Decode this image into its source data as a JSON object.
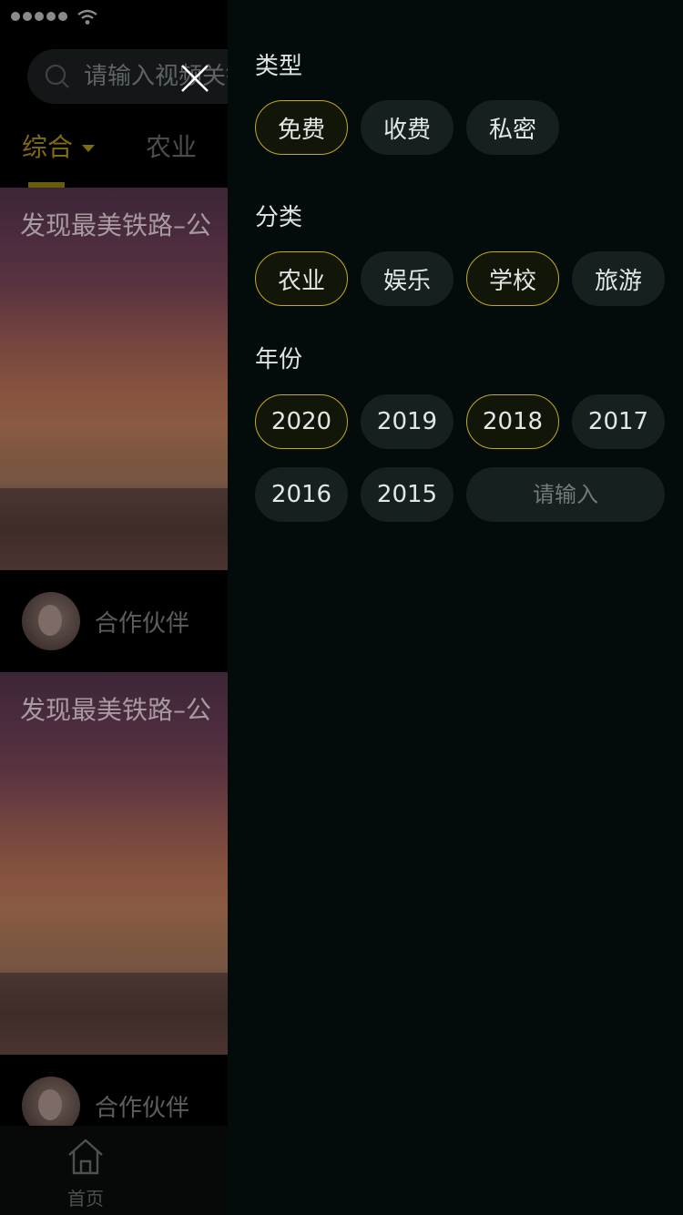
{
  "search": {
    "placeholder": "请输入视频关键词"
  },
  "tabs": [
    {
      "label": "综合",
      "active": true
    },
    {
      "label": "农业",
      "active": false
    }
  ],
  "feed": [
    {
      "title": "发现最美铁路–公",
      "author": "合作伙伴"
    },
    {
      "title": "发现最美铁路–公",
      "author": "合作伙伴"
    }
  ],
  "bottom_nav": {
    "home_label": "首页"
  },
  "filter": {
    "type_title": "类型",
    "type_options": [
      {
        "label": "免费",
        "selected": true
      },
      {
        "label": "收费",
        "selected": false
      },
      {
        "label": "私密",
        "selected": false
      }
    ],
    "category_title": "分类",
    "category_options": [
      {
        "label": "农业",
        "selected": true
      },
      {
        "label": "娱乐",
        "selected": false
      },
      {
        "label": "学校",
        "selected": true
      },
      {
        "label": "旅游",
        "selected": false
      }
    ],
    "year_title": "年份",
    "year_options": [
      {
        "label": "2020",
        "selected": true
      },
      {
        "label": "2019",
        "selected": false
      },
      {
        "label": "2018",
        "selected": true
      },
      {
        "label": "2017",
        "selected": false
      },
      {
        "label": "2016",
        "selected": false
      },
      {
        "label": "2015",
        "selected": false
      }
    ],
    "year_input_placeholder": "请输入"
  },
  "colors": {
    "accent": "#c5a81c",
    "chip_bg": "#162020",
    "drawer_bg": "#040b0b"
  }
}
